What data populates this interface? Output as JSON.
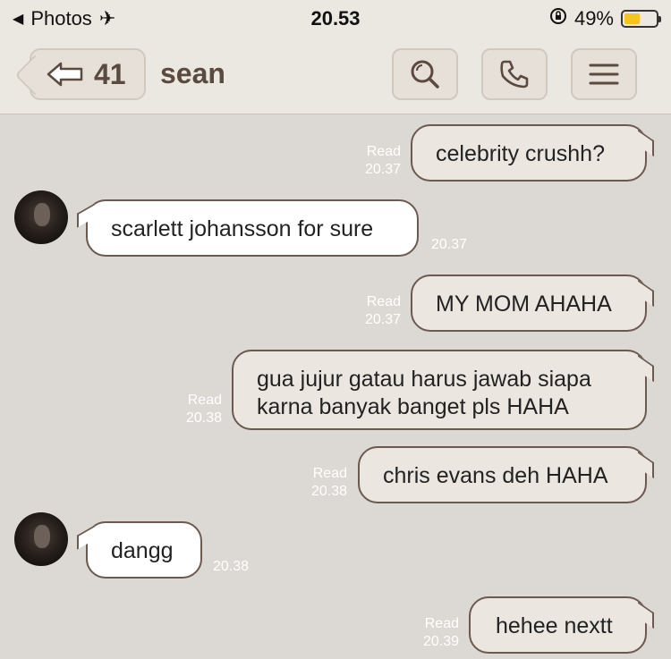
{
  "status_bar": {
    "back_app": "Photos",
    "time": "20.53",
    "battery": "49%",
    "battery_level": 0.49
  },
  "nav": {
    "back_count": "41",
    "title": "sean"
  },
  "messages": [
    {
      "dir": "out",
      "text": "celebrity crushh?",
      "read": "Read",
      "time": "20.37"
    },
    {
      "dir": "in",
      "text": "scarlett johansson for sure",
      "time": "20.37"
    },
    {
      "dir": "out",
      "text": "MY MOM AHAHA",
      "read": "Read",
      "time": "20.37"
    },
    {
      "dir": "out",
      "text": "gua jujur gatau harus jawab siapa",
      "text2": "karna banyak banget pls HAHA",
      "read": "Read",
      "time": "20.38"
    },
    {
      "dir": "out",
      "text": "chris evans deh HAHA",
      "read": "Read",
      "time": "20.38"
    },
    {
      "dir": "in",
      "text": "dangg",
      "time": "20.38"
    },
    {
      "dir": "out",
      "text": "hehee nextt",
      "read": "Read",
      "time": "20.39"
    }
  ],
  "colors": {
    "background": "#dcd8d3",
    "bar": "#ebe7e1",
    "accent": "#5a4a3f",
    "battery": "#f6c41c"
  }
}
